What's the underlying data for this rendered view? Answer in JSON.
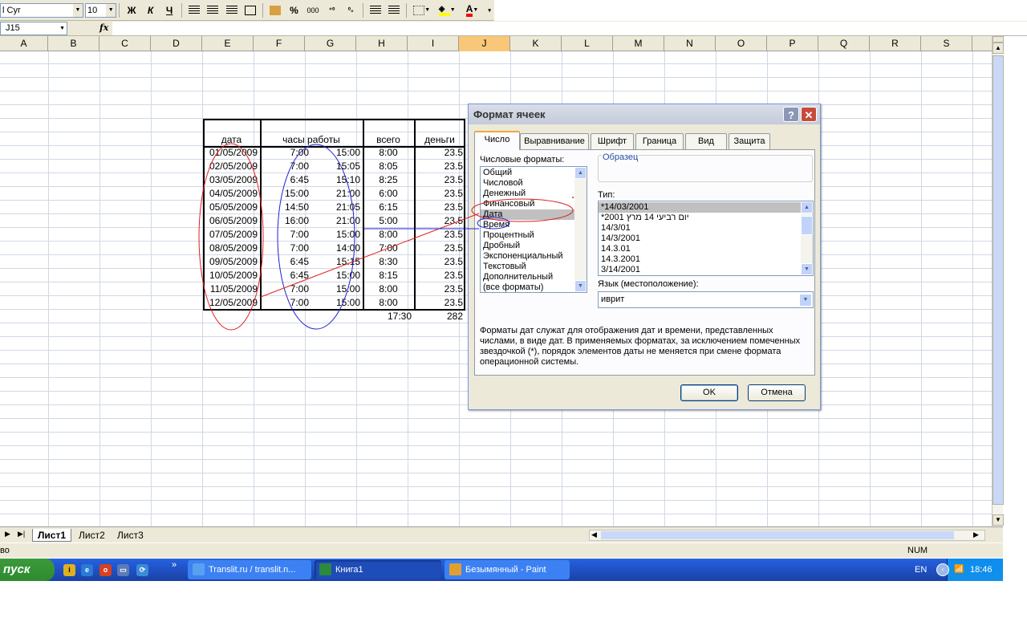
{
  "toolbar": {
    "font_name": "l Cyr",
    "font_size": "10",
    "bold_label": "Ж",
    "italic_label": "К",
    "underline_label": "Ч",
    "percent_label": "%",
    "thousands_label": "000"
  },
  "formula_bar": {
    "name_box": "J15",
    "fx_label": "fx"
  },
  "columns": [
    {
      "label": "A",
      "active": false
    },
    {
      "label": "B",
      "active": false
    },
    {
      "label": "C",
      "active": false
    },
    {
      "label": "D",
      "active": false
    },
    {
      "label": "E",
      "active": false
    },
    {
      "label": "F",
      "active": false
    },
    {
      "label": "G",
      "active": false
    },
    {
      "label": "H",
      "active": false
    },
    {
      "label": "I",
      "active": false
    },
    {
      "label": "J",
      "active": true
    },
    {
      "label": "K",
      "active": false
    },
    {
      "label": "L",
      "active": false
    },
    {
      "label": "M",
      "active": false
    },
    {
      "label": "N",
      "active": false
    },
    {
      "label": "O",
      "active": false
    },
    {
      "label": "P",
      "active": false
    },
    {
      "label": "Q",
      "active": false
    },
    {
      "label": "R",
      "active": false
    },
    {
      "label": "S",
      "active": false
    }
  ],
  "sheet": {
    "headers": {
      "date": "дата",
      "hours": "часы работы",
      "total": "всего",
      "money": "деньги"
    },
    "rows": [
      {
        "date": "01/05/2009",
        "start": "7:00",
        "end": "15:00",
        "total": "8:00",
        "money": "23.5"
      },
      {
        "date": "02/05/2009",
        "start": "7:00",
        "end": "15:05",
        "total": "8:05",
        "money": "23.5"
      },
      {
        "date": "03/05/2009",
        "start": "6:45",
        "end": "15:10",
        "total": "8:25",
        "money": "23.5"
      },
      {
        "date": "04/05/2009",
        "start": "15:00",
        "end": "21:00",
        "total": "6:00",
        "money": "23.5"
      },
      {
        "date": "05/05/2009",
        "start": "14:50",
        "end": "21:05",
        "total": "6:15",
        "money": "23.5"
      },
      {
        "date": "06/05/2009",
        "start": "16:00",
        "end": "21:00",
        "total": "5:00",
        "money": "23.5"
      },
      {
        "date": "07/05/2009",
        "start": "7:00",
        "end": "15:00",
        "total": "8:00",
        "money": "23.5"
      },
      {
        "date": "08/05/2009",
        "start": "7:00",
        "end": "14:00",
        "total": "7:00",
        "money": "23.5"
      },
      {
        "date": "09/05/2009",
        "start": "6:45",
        "end": "15:15",
        "total": "8:30",
        "money": "23.5"
      },
      {
        "date": "10/05/2009",
        "start": "6:45",
        "end": "15:00",
        "total": "8:15",
        "money": "23.5"
      },
      {
        "date": "11/05/2009",
        "start": "7:00",
        "end": "15:00",
        "total": "8:00",
        "money": "23.5"
      },
      {
        "date": "12/05/2009",
        "start": "7:00",
        "end": "15:00",
        "total": "8:00",
        "money": "23.5"
      }
    ],
    "totals": {
      "total": "17:30",
      "money": "282"
    }
  },
  "sheet_tabs": [
    "Лист1",
    "Лист2",
    "Лист3"
  ],
  "status_bar": {
    "left": "во",
    "num": "NUM"
  },
  "taskbar": {
    "start_label": "пуск",
    "tasks": [
      "Translit.ru / translit.n...",
      "Книга1",
      "Безымянный - Paint"
    ],
    "lang": "EN",
    "clock": "18:46"
  },
  "dialog": {
    "title": "Формат ячеек",
    "help_label": "?",
    "close_label": "✕",
    "tabs": [
      "Число",
      "Выравнивание",
      "Шрифт",
      "Граница",
      "Вид",
      "Защита"
    ],
    "number_formats_label": "Числовые форматы:",
    "number_formats": [
      "Общий",
      "Числовой",
      "Денежный",
      "Финансовый",
      "Дата",
      "Время",
      "Процентный",
      "Дробный",
      "Экспоненциальный",
      "Текстовый",
      "Дополнительный",
      "(все форматы)"
    ],
    "selected_format": "Дата",
    "sample_label": "Образец",
    "type_label": "Тип:",
    "types": [
      "*14/03/2001",
      "*יום רביעי 14 מרץ 2001",
      "14/3/01",
      "14/3/2001",
      "14.3.01",
      "14.3.2001",
      "3/14/2001"
    ],
    "selected_type": "*14/03/2001",
    "locale_label": "Язык (местоположение):",
    "locale_value": "иврит",
    "description": "Форматы дат служат для отображения дат и времени, представленных числами, в виде дат. В применяемых форматах, за исключением помеченных звездочкой (*), порядок элементов даты не меняется при смене формата операционной системы.",
    "ok_label": "OK",
    "cancel_label": "Отмена"
  },
  "colors": {
    "annotation_red": "#e02020",
    "annotation_blue": "#2020d0",
    "active_col": "#f8c878"
  }
}
